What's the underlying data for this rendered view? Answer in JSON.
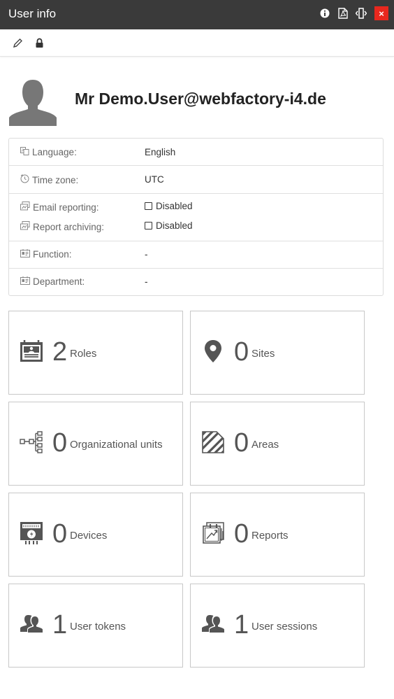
{
  "window": {
    "title": "User info",
    "close_label": "×"
  },
  "user": {
    "display_name": "Mr Demo.User@webfactory-i4.de"
  },
  "info": {
    "language": {
      "label": "Language:",
      "value": "English"
    },
    "timezone": {
      "label": "Time zone:",
      "value": "UTC"
    },
    "email_reporting": {
      "label": "Email reporting:",
      "value": "Disabled"
    },
    "report_archiving": {
      "label": "Report archiving:",
      "value": "Disabled"
    },
    "function": {
      "label": "Function:",
      "value": "-"
    },
    "department": {
      "label": "Department:",
      "value": "-"
    }
  },
  "tiles": [
    {
      "count": "2",
      "label": "Roles",
      "icon": "roles-icon"
    },
    {
      "count": "0",
      "label": "Sites",
      "icon": "map-marker-icon"
    },
    {
      "count": "0",
      "label": "Organizational units",
      "icon": "org-units-icon"
    },
    {
      "count": "0",
      "label": "Areas",
      "icon": "areas-icon"
    },
    {
      "count": "0",
      "label": "Devices",
      "icon": "device-icon"
    },
    {
      "count": "0",
      "label": "Reports",
      "icon": "reports-icon"
    },
    {
      "count": "1",
      "label": "User tokens",
      "icon": "users-icon"
    },
    {
      "count": "1",
      "label": "User sessions",
      "icon": "users-icon"
    }
  ],
  "colors": {
    "titlebar_bg": "#3a3a3a",
    "close_bg": "#e8281e",
    "icon_gray": "#555555"
  }
}
